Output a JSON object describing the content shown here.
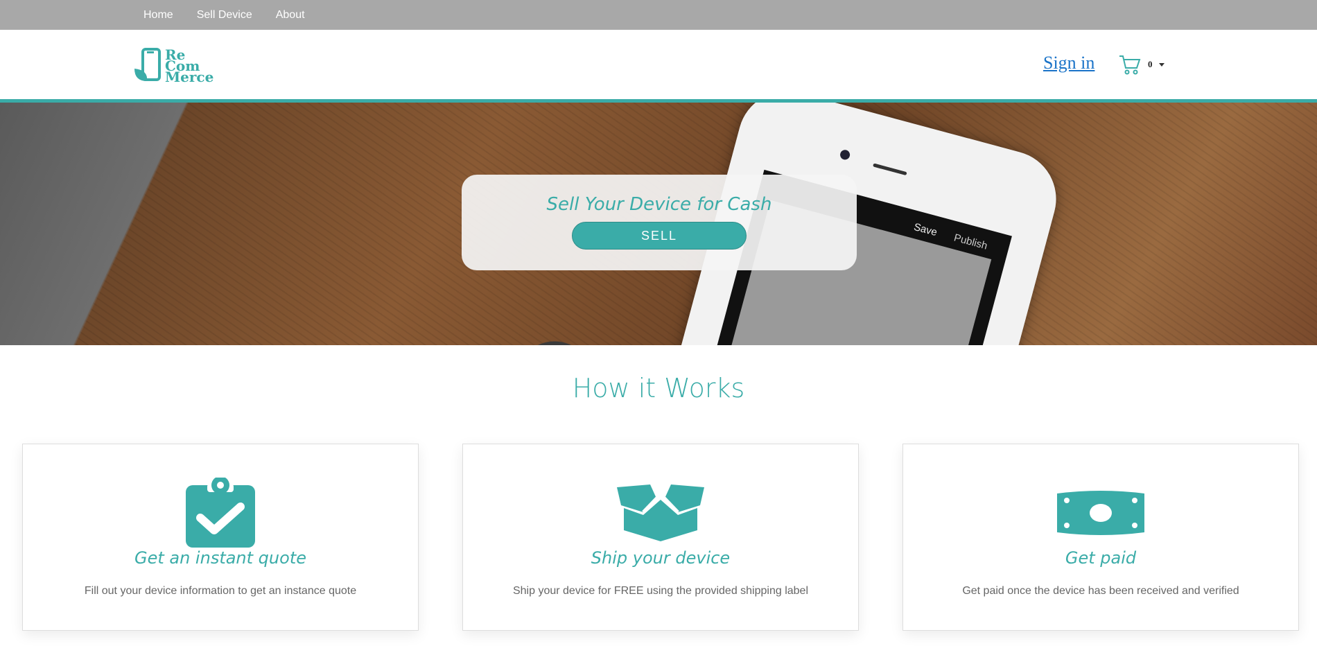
{
  "topnav": {
    "items": [
      {
        "label": "Home"
      },
      {
        "label": "Sell Device"
      },
      {
        "label": "About"
      }
    ]
  },
  "header": {
    "logo": {
      "line1": "Re",
      "line2": "Com",
      "line3": "Merce"
    },
    "signin": "Sign in",
    "cart_count": "0"
  },
  "hero": {
    "title": "Sell Your Device for Cash",
    "button": "SELL",
    "phone_save": "Save",
    "phone_publish": "Publish"
  },
  "how": {
    "title": "How it Works",
    "cards": [
      {
        "icon": "clipboard-check-icon",
        "title": "Get an instant quote",
        "desc": "Fill out your device information to get an instance quote"
      },
      {
        "icon": "box-icon",
        "title": "Ship your device",
        "desc": "Ship your device for FREE using the provided shipping label"
      },
      {
        "icon": "money-bill-icon",
        "title": "Get paid",
        "desc": "Get paid once the device has been received and verified"
      }
    ]
  },
  "colors": {
    "accent": "#3aaca8",
    "topnav_bg": "#a8a8a8",
    "link": "#1a73c8"
  }
}
